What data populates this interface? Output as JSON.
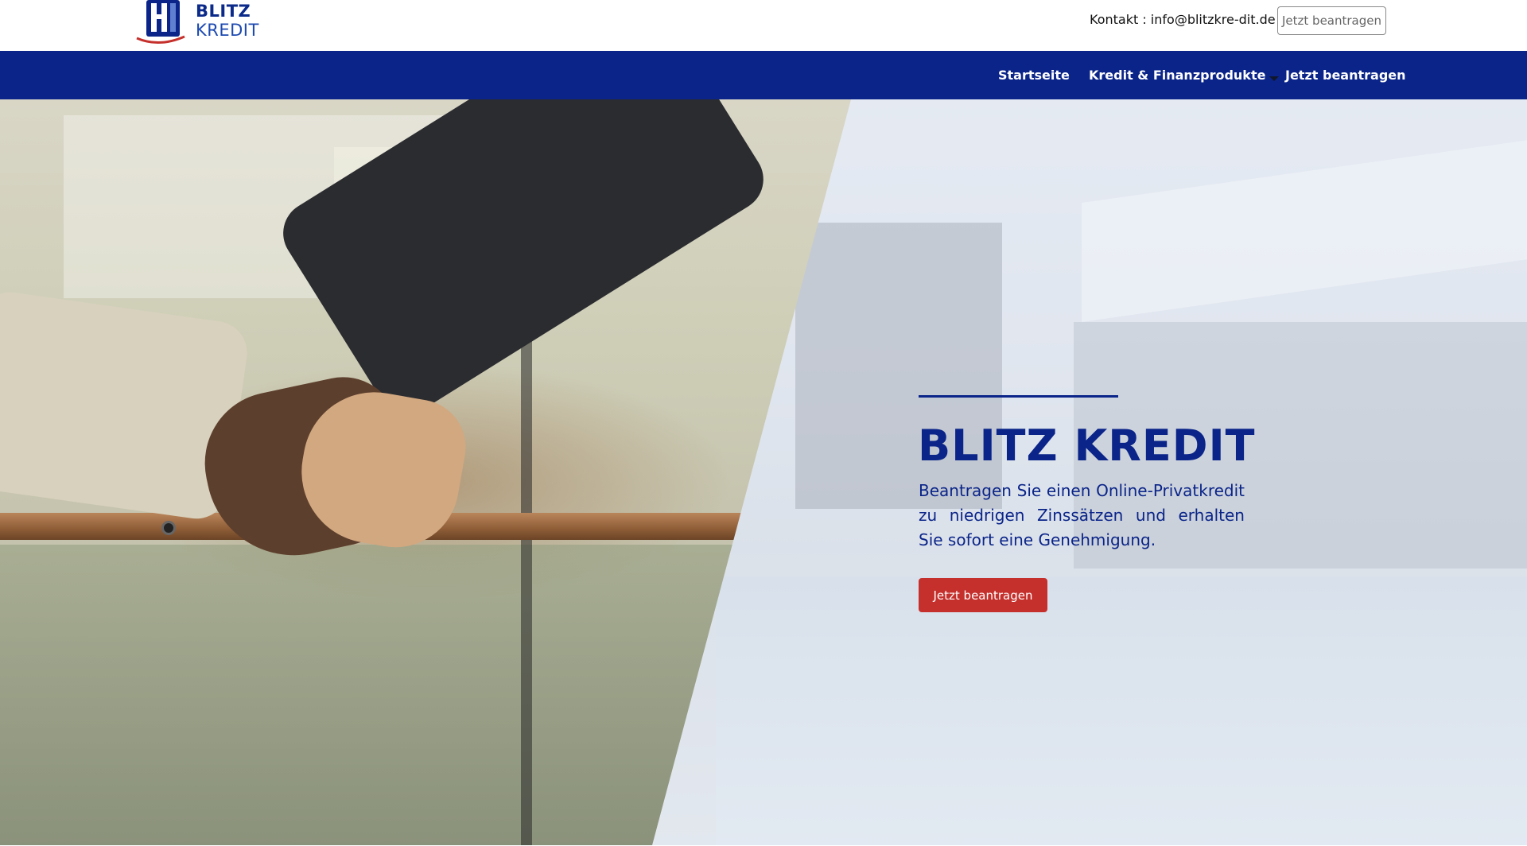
{
  "header": {
    "logo": {
      "line1": "BLITZ",
      "line2": "KREDIT"
    },
    "contact_text": "Kontakt : info@blitzkre-dit.de",
    "cta_label": "Jetzt beantragen"
  },
  "nav": {
    "items": [
      {
        "label": "Startseite"
      },
      {
        "label": "Kredit & Finanzprodukte",
        "icon": "caret-down-icon"
      },
      {
        "label": "Jetzt beantragen"
      }
    ]
  },
  "hero": {
    "title": "BLITZ KREDIT",
    "subtitle": "Beantragen Sie einen Online-Privatkredit zu niedrigen Zinssätzen und erhalten Sie sofort eine Genehmigung.",
    "cta_label": "Jetzt beantragen",
    "left_image": "handshake-photo",
    "right_image": "modern-house-pool-photo"
  },
  "colors": {
    "brand_blue": "#0a2489",
    "cta_red": "#c5302c",
    "header_bg": "#ffffff"
  }
}
